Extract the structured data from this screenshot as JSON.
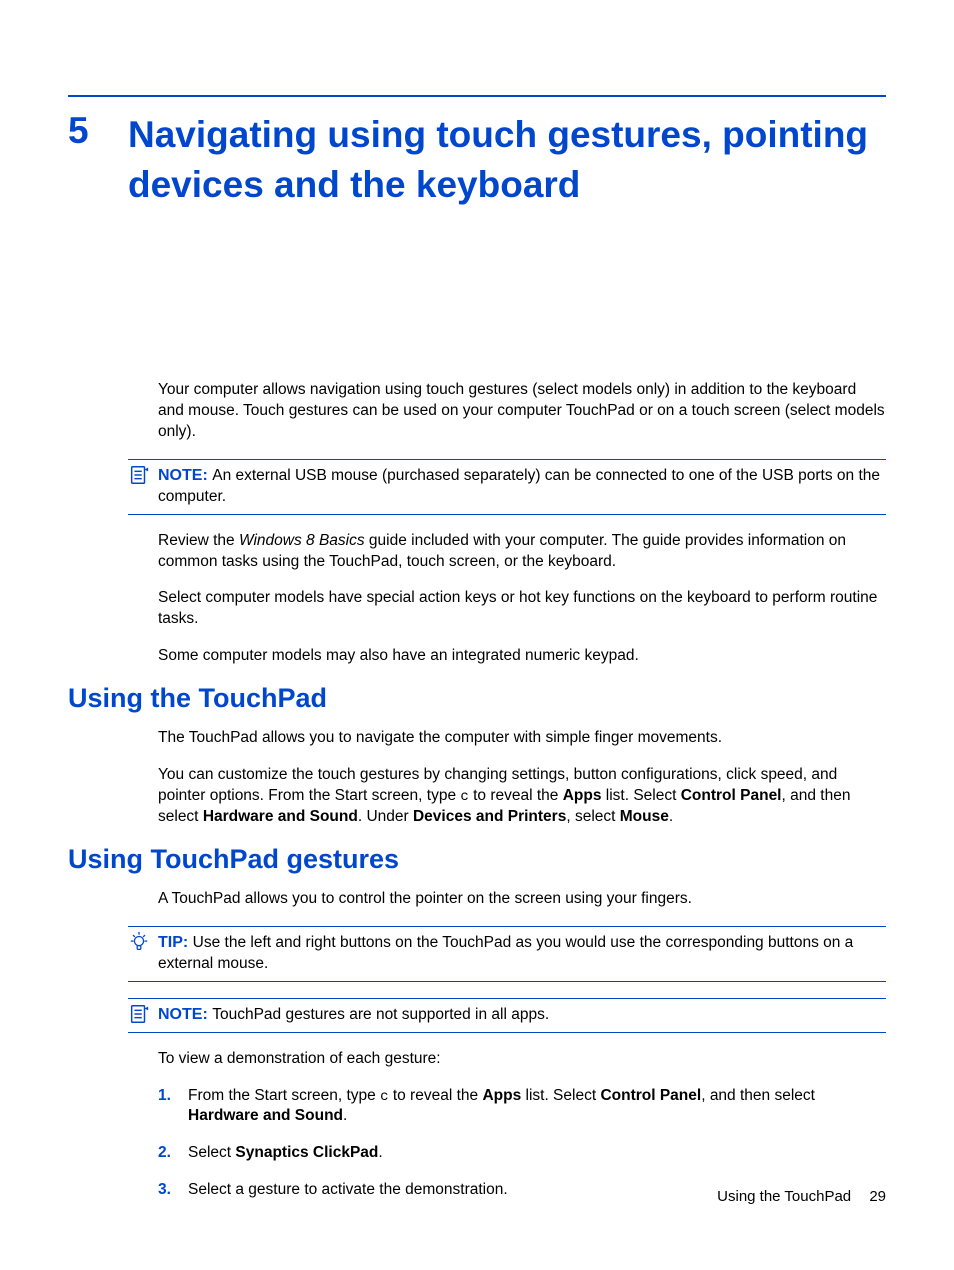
{
  "chapter": {
    "number": "5",
    "title": "Navigating using touch gestures, pointing devices and the keyboard"
  },
  "intro": {
    "p1": "Your computer allows navigation using touch gestures (select models only) in addition to the keyboard and mouse. Touch gestures can be used on your computer TouchPad or on a touch screen (select models only)."
  },
  "note1": {
    "label": "NOTE:",
    "text": "An external USB mouse (purchased separately) can be connected to one of the USB ports on the computer."
  },
  "intro2": {
    "p2_pre": "Review the ",
    "p2_italic": "Windows 8 Basics",
    "p2_post": " guide included with your computer. The guide provides information on common tasks using the TouchPad, touch screen, or the keyboard.",
    "p3": "Select computer models have special action keys or hot key functions on the keyboard to perform routine tasks.",
    "p4": "Some computer models may also have an integrated numeric keypad."
  },
  "section1": {
    "heading": "Using the TouchPad",
    "p1": "The TouchPad allows you to navigate the computer with simple finger movements.",
    "p2_a": "You can customize the touch gestures by changing settings, button configurations, click speed, and pointer options. From the Start screen, type ",
    "p2_code": "c",
    "p2_b": " to reveal the ",
    "p2_bold1": "Apps",
    "p2_c": " list. Select ",
    "p2_bold2": "Control Panel",
    "p2_d": ", and then select ",
    "p2_bold3": "Hardware and Sound",
    "p2_e": ". Under ",
    "p2_bold4": "Devices and Printers",
    "p2_f": ", select ",
    "p2_bold5": "Mouse",
    "p2_g": "."
  },
  "section2": {
    "heading": "Using TouchPad gestures",
    "p1": "A TouchPad allows you to control the pointer on the screen using your fingers."
  },
  "tip1": {
    "label": "TIP:",
    "text": "Use the left and right buttons on the TouchPad as you would use the corresponding buttons on a external mouse."
  },
  "note2": {
    "label": "NOTE:",
    "text": "TouchPad gestures are not supported in all apps."
  },
  "demo": {
    "lead": "To view a demonstration of each gesture:",
    "step1_a": "From the Start screen, type ",
    "step1_code": "c",
    "step1_b": " to reveal the ",
    "step1_bold1": "Apps",
    "step1_c": " list. Select ",
    "step1_bold2": "Control Panel",
    "step1_d": ", and then select ",
    "step1_bold3": "Hardware and Sound",
    "step1_e": ".",
    "step2_a": "Select ",
    "step2_bold": "Synaptics ClickPad",
    "step2_b": ".",
    "step3": "Select a gesture to activate the demonstration."
  },
  "footer": {
    "section": "Using the TouchPad",
    "page": "29"
  }
}
